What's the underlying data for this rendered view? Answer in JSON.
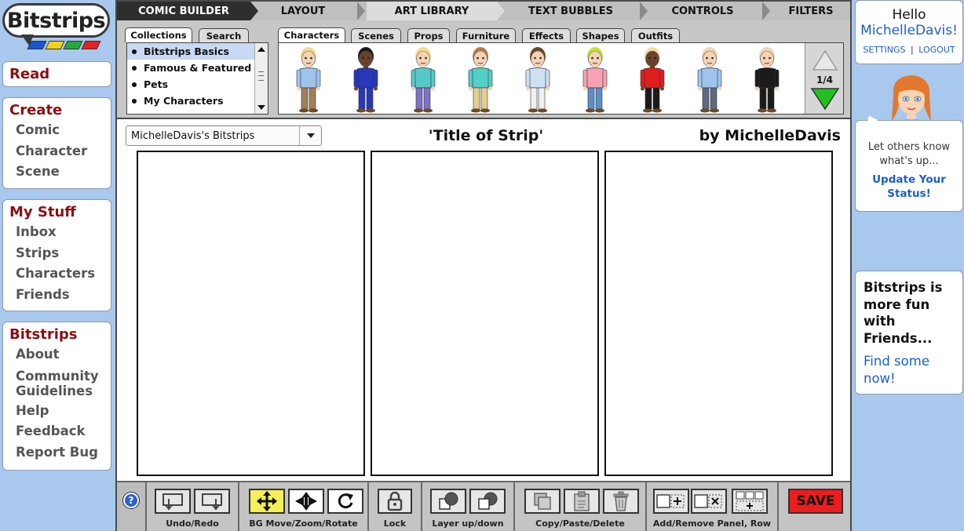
{
  "logo": {
    "text": "Bitstrips",
    "bar_colors": [
      "#1d56c8",
      "#f1d21a",
      "#27a83c",
      "#e82222"
    ]
  },
  "left_nav": {
    "read": "Read",
    "create": {
      "heading": "Create",
      "items": [
        "Comic",
        "Character",
        "Scene"
      ]
    },
    "my_stuff": {
      "heading": "My Stuff",
      "items": [
        "Inbox",
        "Strips",
        "Characters",
        "Friends"
      ]
    },
    "bitstrips": {
      "heading": "Bitstrips",
      "items": [
        "About",
        "Community Guidelines",
        "Help",
        "Feedback",
        "Report Bug"
      ]
    }
  },
  "top_tabs": [
    "COMIC BUILDER",
    "LAYOUT",
    "ART LIBRARY",
    "TEXT BUBBLES",
    "CONTROLS",
    "FILTERS"
  ],
  "active_top_tab": "ART LIBRARY",
  "library": {
    "left_tabs": [
      "Collections",
      "Search"
    ],
    "collections": [
      "Bitstrips Basics",
      "Famous & Featured",
      "Pets",
      "My Characters"
    ],
    "selected_collection": "Bitstrips Basics",
    "category_tabs": [
      "Characters",
      "Scenes",
      "Props",
      "Furniture",
      "Effects",
      "Shapes",
      "Outfits"
    ],
    "active_category": "Characters",
    "page": "1/4",
    "characters": [
      {
        "name": "character-blonde-man",
        "hair": "#f0dc8c",
        "skin": "#f4d3b4",
        "shirt": "#9fc4ec",
        "pants": "#a0805a"
      },
      {
        "name": "character-man-blue-suit",
        "hair": "#1a1a1a",
        "skin": "#6b4328",
        "shirt": "#2838b8",
        "pants": "#2838b8"
      },
      {
        "name": "character-blonde-woman",
        "hair": "#f2e08a",
        "skin": "#f4d3b4",
        "shirt": "#57c8c8",
        "pants": "#7c72c6"
      },
      {
        "name": "character-woman-teal",
        "hair": "#b87a4a",
        "skin": "#f4d3b4",
        "shirt": "#52cfc7",
        "pants": "#e3cf8f"
      },
      {
        "name": "character-man-tie",
        "hair": "#6b4a2a",
        "skin": "#f4d3b4",
        "shirt": "#cfe0f4",
        "pants": "#f0f0f0"
      },
      {
        "name": "character-girl-pigtails",
        "hair": "#c6e23a",
        "skin": "#f4d3b4",
        "shirt": "#f4a2b4",
        "pants": "#5c8ec8"
      },
      {
        "name": "character-woman-red",
        "hair": "#f2e0a0",
        "skin": "#6b4328",
        "shirt": "#e01d1d",
        "pants": "#1a1a1a"
      },
      {
        "name": "character-bald-man-blue",
        "hair": "#f4d3b4",
        "skin": "#f4d3b4",
        "shirt": "#9fc4ec",
        "pants": "#5d6a80"
      },
      {
        "name": "character-man-black-suit",
        "hair": "#f4d3b4",
        "skin": "#f4d3b4",
        "shirt": "#1a1a1a",
        "pants": "#1a1a1a"
      }
    ]
  },
  "strip": {
    "selector_value": "MichelleDavis's Bitstrips",
    "title": "'Title of Strip'",
    "author": "by MichelleDavis",
    "panels": 3
  },
  "toolbar": {
    "help": "?",
    "groups": [
      "Undo/Redo",
      "BG Move/Zoom/Rotate",
      "Lock",
      "Layer up/down",
      "Copy/Paste/Delete",
      "Add/Remove Panel, Row"
    ],
    "save": "SAVE"
  },
  "account": {
    "hello": "Hello",
    "username": "MichelleDavis!",
    "settings": "SETTINGS",
    "separator": "|",
    "logout": "LOGOUT"
  },
  "status_box": {
    "text": "Let others know what's up...",
    "link": "Update Your Status!"
  },
  "friends_box": {
    "text": "Bitstrips is more fun with Friends...",
    "link": "Find some now!"
  }
}
